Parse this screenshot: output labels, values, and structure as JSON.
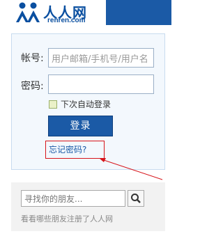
{
  "header": {
    "logo_cn": "人人网",
    "logo_en": "renren.com"
  },
  "login": {
    "account_label": "帐号:",
    "account_placeholder": "用户邮箱/手机号/用户名",
    "password_label": "密码:",
    "password_value": "",
    "remember_label": "下次自动登录",
    "remember_checked": false,
    "submit_label": "登录",
    "forgot_label": "忘记密码?"
  },
  "find_friends": {
    "search_placeholder": "寻找你的朋友...",
    "link_label": "看看哪些朋友注册了人人网"
  },
  "colors": {
    "brand_blue": "#1b5aa6",
    "annotation_red": "#d7141a",
    "panel_bg": "#f3f8fd"
  },
  "icons": {
    "logo": "renren-people-logo-icon",
    "search": "magnifier-icon",
    "annotation": "red-arrow-icon"
  }
}
